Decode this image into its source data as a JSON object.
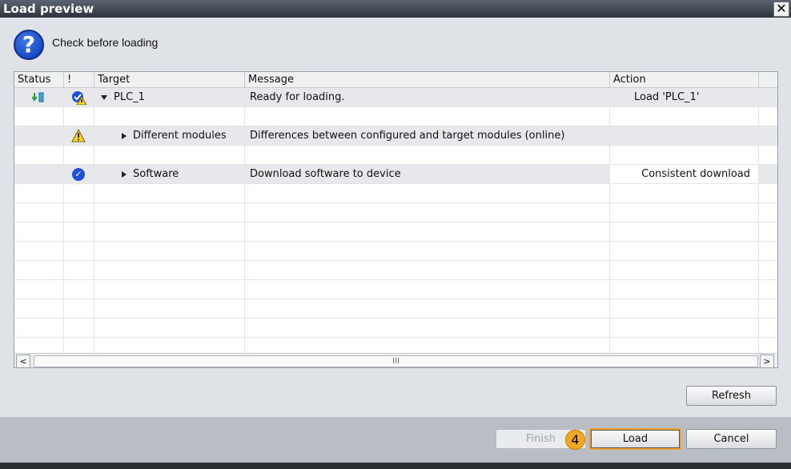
{
  "window": {
    "title": "Load preview",
    "close_glyph": "✕"
  },
  "header": {
    "text": "Check before loading",
    "icon": "help-icon"
  },
  "table": {
    "columns": [
      "Status",
      "!",
      "Target",
      "Message",
      "Action"
    ],
    "rows": [
      {
        "status_icon": "download-icon",
        "flag_icon": "ok-warning-icon",
        "expand": "expanded",
        "target": "PLC_1",
        "message": "Ready for loading.",
        "action": "Load 'PLC_1'"
      },
      {
        "target": "",
        "message": "",
        "action": ""
      },
      {
        "flag_icon": "warning-icon",
        "expand": "collapsed",
        "target": "Different modules",
        "message": "Differences between configured and target modules (online)",
        "action": ""
      },
      {
        "target": "",
        "message": "",
        "action": ""
      },
      {
        "flag_icon": "ok-icon",
        "expand": "collapsed",
        "target": "Software",
        "message": "Download software to device",
        "action": "Consistent download"
      }
    ]
  },
  "scrollbar": {
    "left": "<",
    "right": ">",
    "thumb": "III"
  },
  "buttons": {
    "refresh": "Refresh",
    "finish": "Finish",
    "load": "Load",
    "cancel": "Cancel"
  },
  "callout": {
    "number": "4"
  },
  "colors": {
    "accent": "#f5a623",
    "ok": "#1f4fd6",
    "warning": "#f2d22e"
  }
}
